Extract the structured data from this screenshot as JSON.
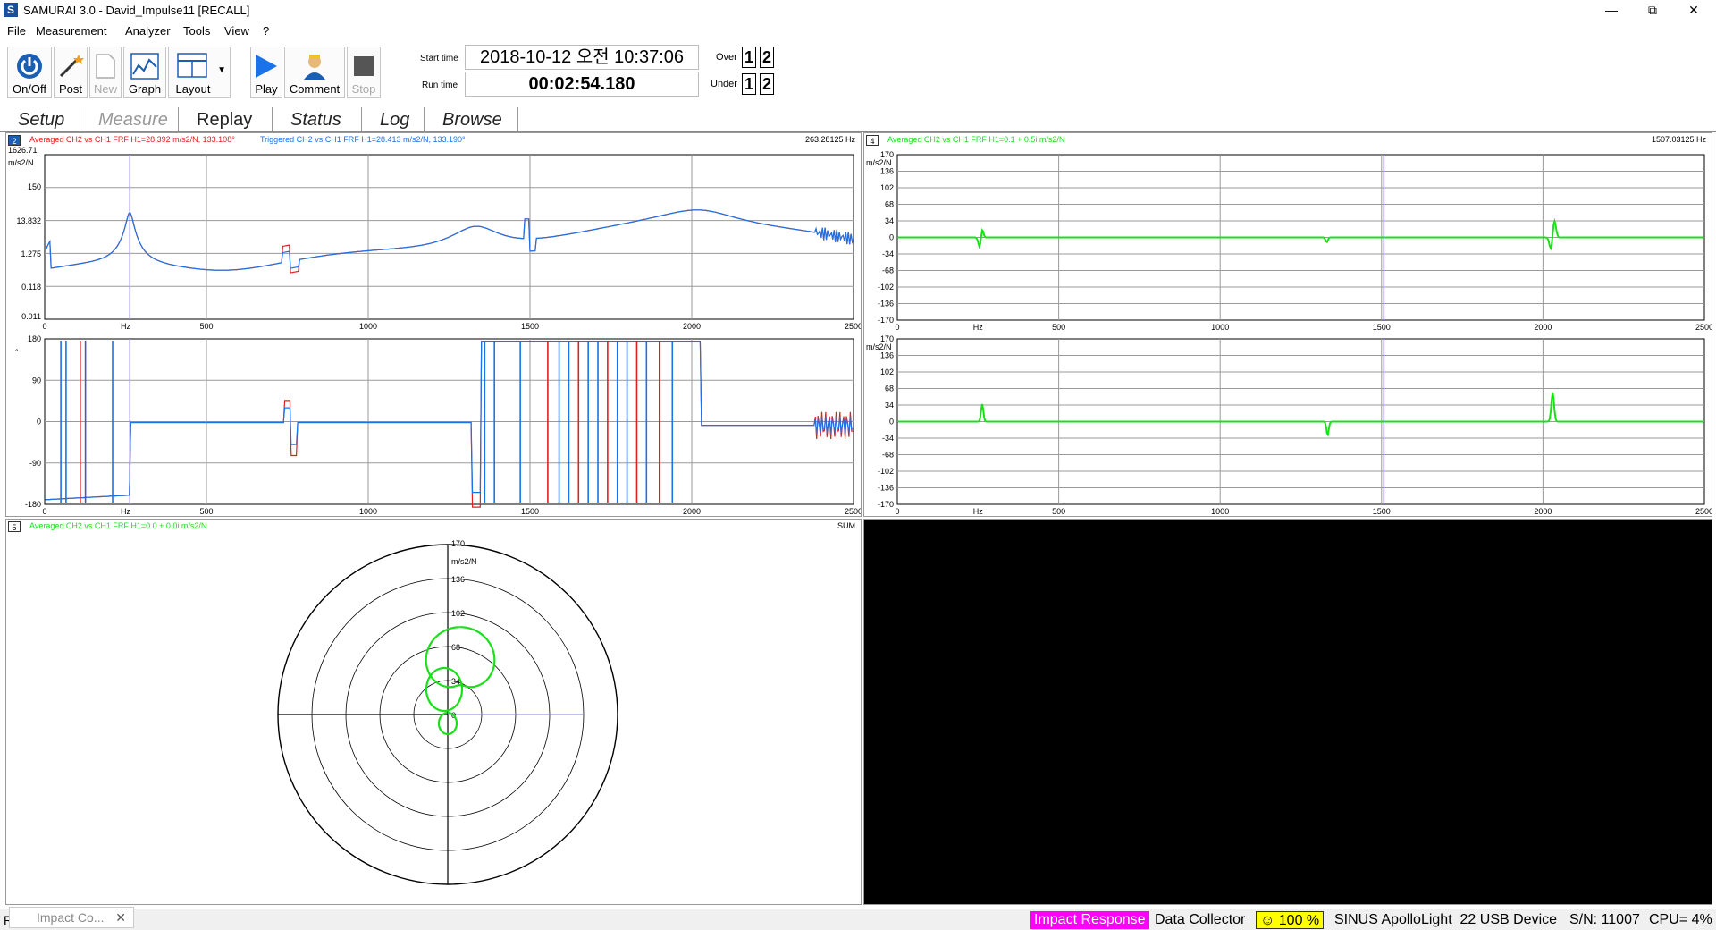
{
  "window": {
    "title": "SAMURAI 3.0 - David_Impulse11 [RECALL]",
    "icon_letter": "S",
    "minimize": "—",
    "maximize": "⧉",
    "close": "✕"
  },
  "menu": [
    "File",
    "Measurement",
    "Analyzer",
    "Tools",
    "View",
    "?"
  ],
  "toolbar": {
    "buttons": [
      "On/Off",
      "Post",
      "New",
      "Graph",
      "Layout",
      "Play",
      "Comment",
      "Stop"
    ],
    "start_time_label": "Start time",
    "start_time": "2018-10-12 오전 10:37:06",
    "run_time_label": "Run time",
    "run_time": "00:02:54.180",
    "over_label": "Over",
    "under_label": "Under",
    "ch1": "1",
    "ch2": "2"
  },
  "tabs": [
    "Setup",
    "Measure",
    "Replay",
    "Status",
    "Log",
    "Browse"
  ],
  "panels": {
    "p2": {
      "num": "2",
      "trace_a": "Averaged CH2 vs CH1 FRF H1=28.392 m/s2/N, 133.108°",
      "trace_b": "Triggered CH2 vs CH1 FRF H1=28.413 m/s2/N, 133.190°",
      "cursor": "263.28125 Hz",
      "mag_unit": "m/s2/N",
      "mag_ticks": [
        "1626.71",
        "150",
        "13.832",
        "1.275",
        "0.118",
        "0.011"
      ],
      "phase_unit": "°",
      "phase_ticks": [
        "180",
        "90",
        "0",
        "-90",
        "-180"
      ],
      "x_ticks": [
        "0",
        "Hz",
        "500",
        "1000",
        "1500",
        "2000",
        "2500"
      ]
    },
    "p4": {
      "num": "4",
      "trace": "Averaged CH2 vs CH1 FRF H1=0.1 + 0.5i m/s2/N",
      "cursor": "1507.03125 Hz",
      "unit": "m/s2/N",
      "y_ticks": [
        "170",
        "136",
        "102",
        "68",
        "34",
        "0",
        "-34",
        "-68",
        "-102",
        "-136",
        "-170"
      ],
      "x_ticks": [
        "0",
        "Hz",
        "500",
        "1000",
        "1500",
        "2000",
        "2500"
      ]
    },
    "p5": {
      "num": "5",
      "trace": "Averaged CH2 vs CH1 FRF H1=0.0 + 0.0i m/s2/N",
      "label_right": "SUM",
      "unit": "m/s2/N",
      "r_ticks": [
        "170",
        "136",
        "102",
        "68",
        "34",
        "0"
      ]
    }
  },
  "status": {
    "left_char": "R",
    "floating_tab": "Impact Co...",
    "mode": "Impact Response",
    "collector": "Data Collector",
    "battery": "☺ 100 %",
    "device": "SINUS ApolloLight_22 USB Device",
    "serial": "S/N: 11007",
    "cpu": "CPU=   4%"
  },
  "colors": {
    "red": "#e02020",
    "blue": "#1a73e8",
    "green": "#19e019",
    "accent": "#1a5fb4",
    "magenta": "#ff00ff",
    "yellow": "#ffff00"
  }
}
